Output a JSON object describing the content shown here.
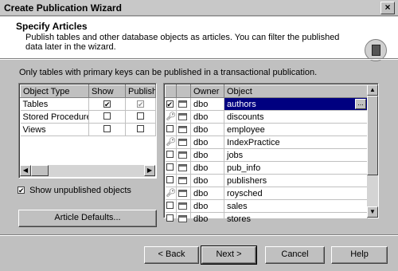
{
  "window": {
    "title": "Create Publication Wizard",
    "close_label": "×"
  },
  "header": {
    "title": "Specify Articles",
    "subtitle": "Publish tables and other database objects as articles. You can filter the published data later in the wizard.",
    "icon": "publication-book-icon"
  },
  "note": "Only tables with primary keys can be published in a transactional publication.",
  "object_types": {
    "columns": [
      "Object Type",
      "Show",
      "Publish A"
    ],
    "rows": [
      {
        "type": "Tables",
        "show": true,
        "publish": true,
        "publish_disabled": true
      },
      {
        "type": "Stored Procedures",
        "show": false,
        "publish": false,
        "publish_disabled": false
      },
      {
        "type": "Views",
        "show": false,
        "publish": false,
        "publish_disabled": false
      }
    ]
  },
  "show_unpublished": {
    "label": "Show unpublished objects",
    "checked": true
  },
  "article_defaults_label": "Article Defaults...",
  "objects": {
    "columns": [
      "",
      "",
      "Owner",
      "Object"
    ],
    "rows": [
      {
        "checked": true,
        "nokey": false,
        "owner": "dbo",
        "name": "authors",
        "selected": true
      },
      {
        "checked": false,
        "nokey": true,
        "owner": "dbo",
        "name": "discounts",
        "selected": false
      },
      {
        "checked": false,
        "nokey": false,
        "owner": "dbo",
        "name": "employee",
        "selected": false
      },
      {
        "checked": false,
        "nokey": true,
        "owner": "dbo",
        "name": "IndexPractice",
        "selected": false
      },
      {
        "checked": false,
        "nokey": false,
        "owner": "dbo",
        "name": "jobs",
        "selected": false
      },
      {
        "checked": false,
        "nokey": false,
        "owner": "dbo",
        "name": "pub_info",
        "selected": false
      },
      {
        "checked": false,
        "nokey": false,
        "owner": "dbo",
        "name": "publishers",
        "selected": false
      },
      {
        "checked": false,
        "nokey": true,
        "owner": "dbo",
        "name": "roysched",
        "selected": false
      },
      {
        "checked": false,
        "nokey": false,
        "owner": "dbo",
        "name": "sales",
        "selected": false
      },
      {
        "checked": false,
        "nokey": false,
        "owner": "dbo",
        "name": "stores",
        "selected": false
      }
    ],
    "ellipsis": "..."
  },
  "buttons": {
    "back": "< Back",
    "next": "Next >",
    "cancel": "Cancel",
    "help": "Help"
  }
}
